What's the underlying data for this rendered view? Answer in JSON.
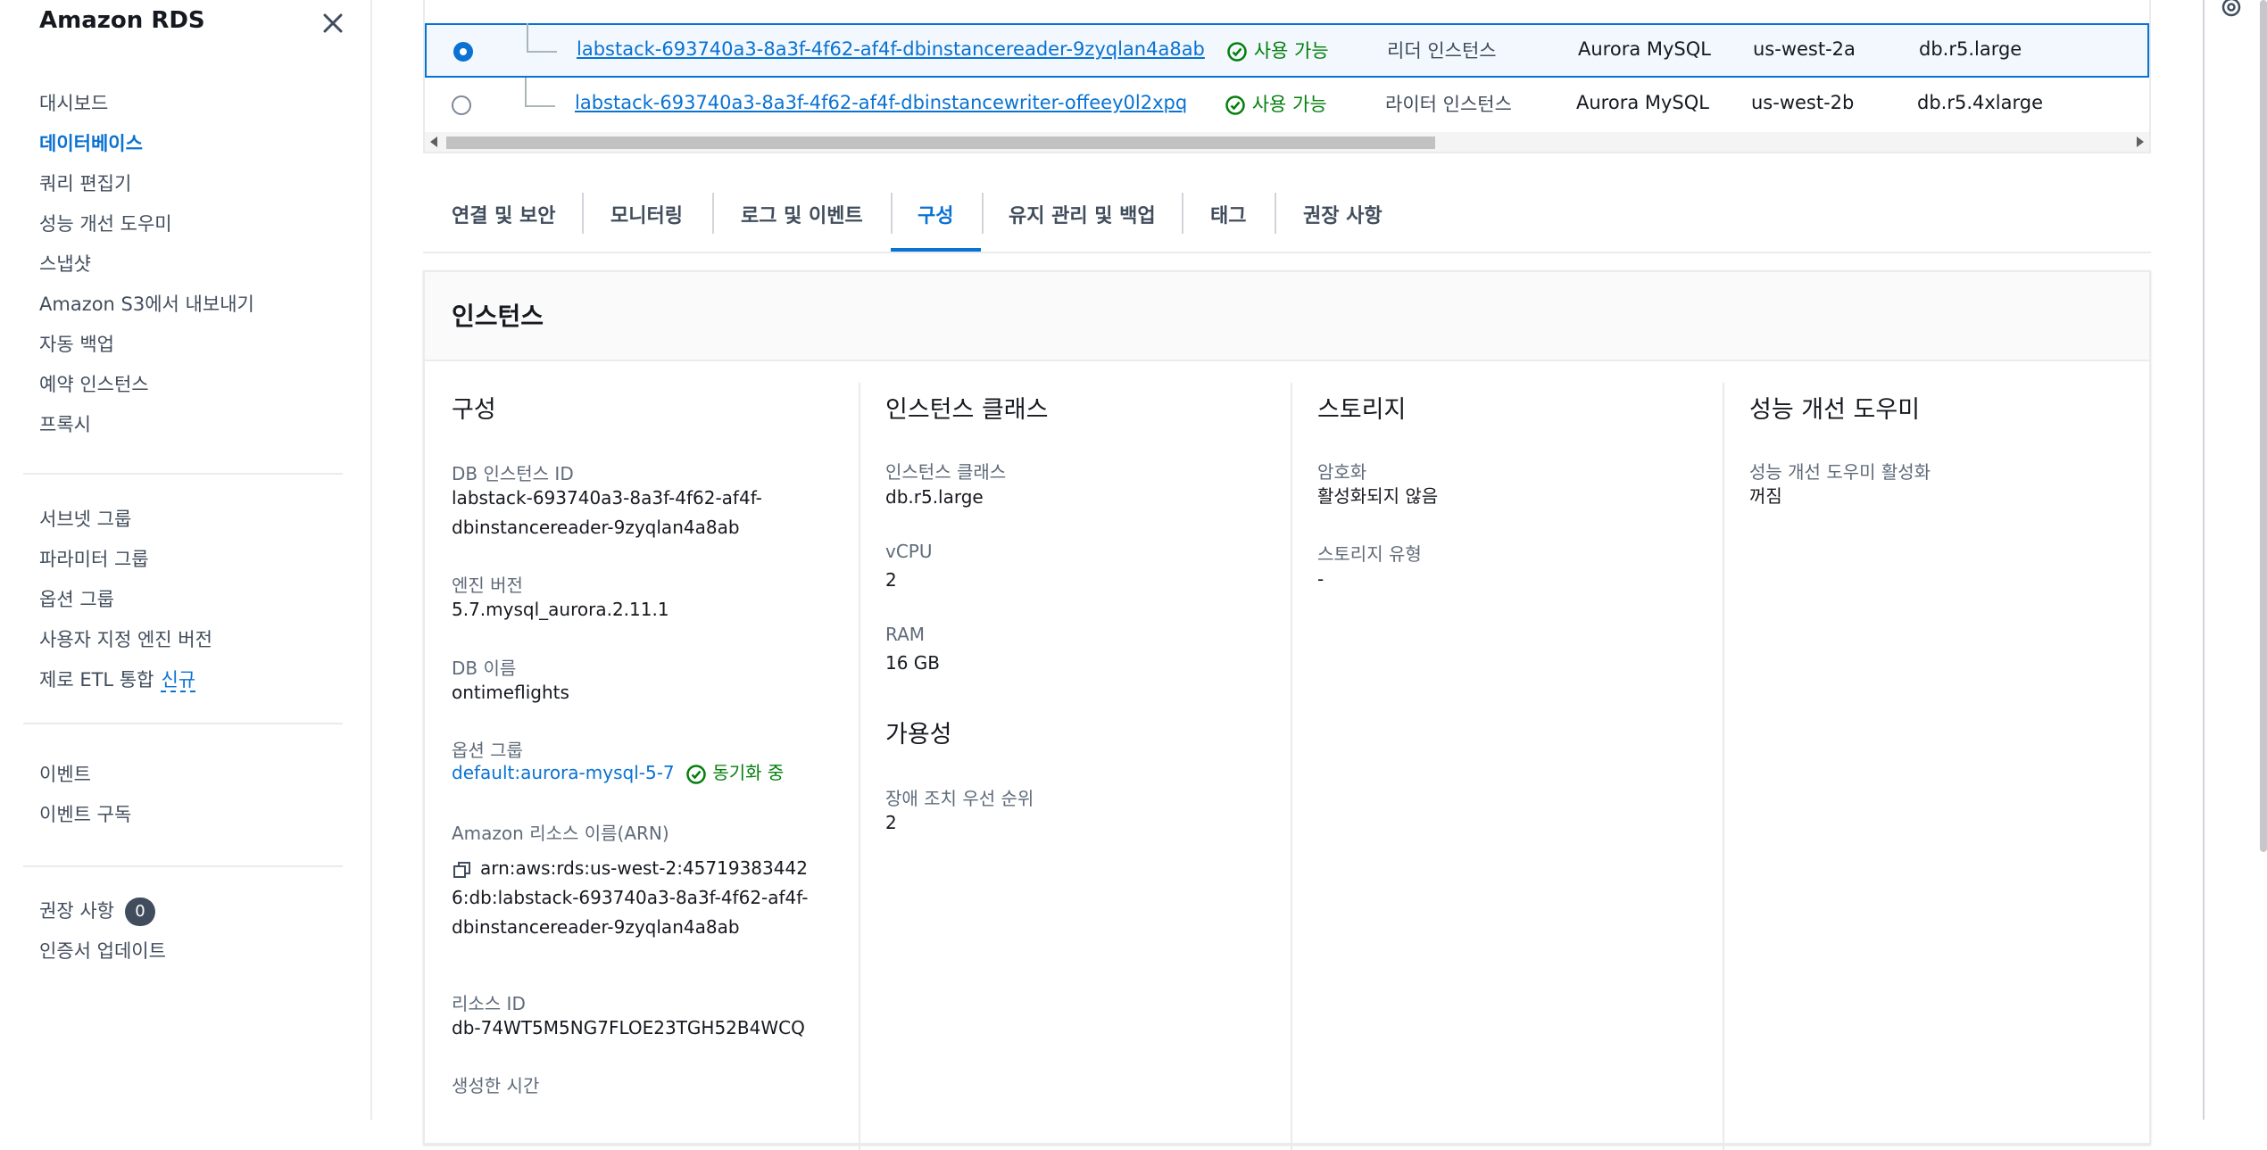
{
  "sidebar": {
    "title": "Amazon RDS",
    "group1": [
      "대시보드",
      "데이터베이스",
      "쿼리 편집기",
      "성능 개선 도우미",
      "스냅샷",
      "Amazon S3에서 내보내기",
      "자동 백업",
      "예약 인스턴스",
      "프록시"
    ],
    "group2": [
      "서브넷 그룹",
      "파라미터 그룹",
      "옵션 그룹",
      "사용자 지정 엔진 버전",
      "제로 ETL 통합"
    ],
    "new_label": "신규",
    "group3": [
      "이벤트",
      "이벤트 구독"
    ],
    "recommendations": "권장 사항",
    "recommendations_count": "0",
    "cert_update": "인증서 업데이트"
  },
  "table": {
    "rows": [
      {
        "name": "labstack-693740a3-8a3f-4f62-af4f-dbinstancereader-9zyqlan4a8ab",
        "status": "사용 가능",
        "role": "리더 인스턴스",
        "engine": "Aurora MySQL",
        "region": "us-west-2a",
        "size": "db.r5.large",
        "selected": true
      },
      {
        "name": "labstack-693740a3-8a3f-4f62-af4f-dbinstancewriter-offeey0l2xpq",
        "status": "사용 가능",
        "role": "라이터 인스턴스",
        "engine": "Aurora MySQL",
        "region": "us-west-2b",
        "size": "db.r5.4xlarge",
        "selected": false
      }
    ]
  },
  "tabs": [
    "연결 및 보안",
    "모니터링",
    "로그 및 이벤트",
    "구성",
    "유지 관리 및 백업",
    "태그",
    "권장 사항"
  ],
  "active_tab": "구성",
  "panel": {
    "title": "인스턴스",
    "config": {
      "title": "구성",
      "db_instance_id_label": "DB 인스턴스 ID",
      "db_instance_id": "labstack-693740a3-8a3f-4f62-af4f-dbinstancereader-9zyqlan4a8ab",
      "engine_version_label": "엔진 버전",
      "engine_version": "5.7.mysql_aurora.2.11.1",
      "db_name_label": "DB 이름",
      "db_name": "ontimeflights",
      "option_group_label": "옵션 그룹",
      "option_group": "default:aurora-mysql-5-7",
      "option_group_status": "동기화 중",
      "arn_label": "Amazon 리소스 이름(ARN)",
      "arn": "arn:aws:rds:us-west-2:457193834426:db:labstack-693740a3-8a3f-4f62-af4f-dbinstancereader-9zyqlan4a8ab",
      "resource_id_label": "리소스 ID",
      "resource_id": "db-74WT5M5NG7FLOE23TGH52B4WCQ",
      "created_label": "생성한 시간"
    },
    "instance_class": {
      "title": "인스턴스 클래스",
      "class_label": "인스턴스 클래스",
      "class_value": "db.r5.large",
      "vcpu_label": "vCPU",
      "vcpu_value": "2",
      "ram_label": "RAM",
      "ram_value": "16 GB",
      "availability_title": "가용성",
      "failover_label": "장애 조치 우선 순위",
      "failover_value": "2"
    },
    "storage": {
      "title": "스토리지",
      "encryption_label": "암호화",
      "encryption_value": "활성화되지 않음",
      "type_label": "스토리지 유형",
      "type_value": "-"
    },
    "perf": {
      "title": "성능 개선 도우미",
      "enabled_label": "성능 개선 도우미 활성화",
      "enabled_value": "꺼짐"
    }
  },
  "colors": {
    "link": "#0972d3",
    "success": "#037f0c",
    "text": "#16191f",
    "muted": "#5f6b7a"
  }
}
